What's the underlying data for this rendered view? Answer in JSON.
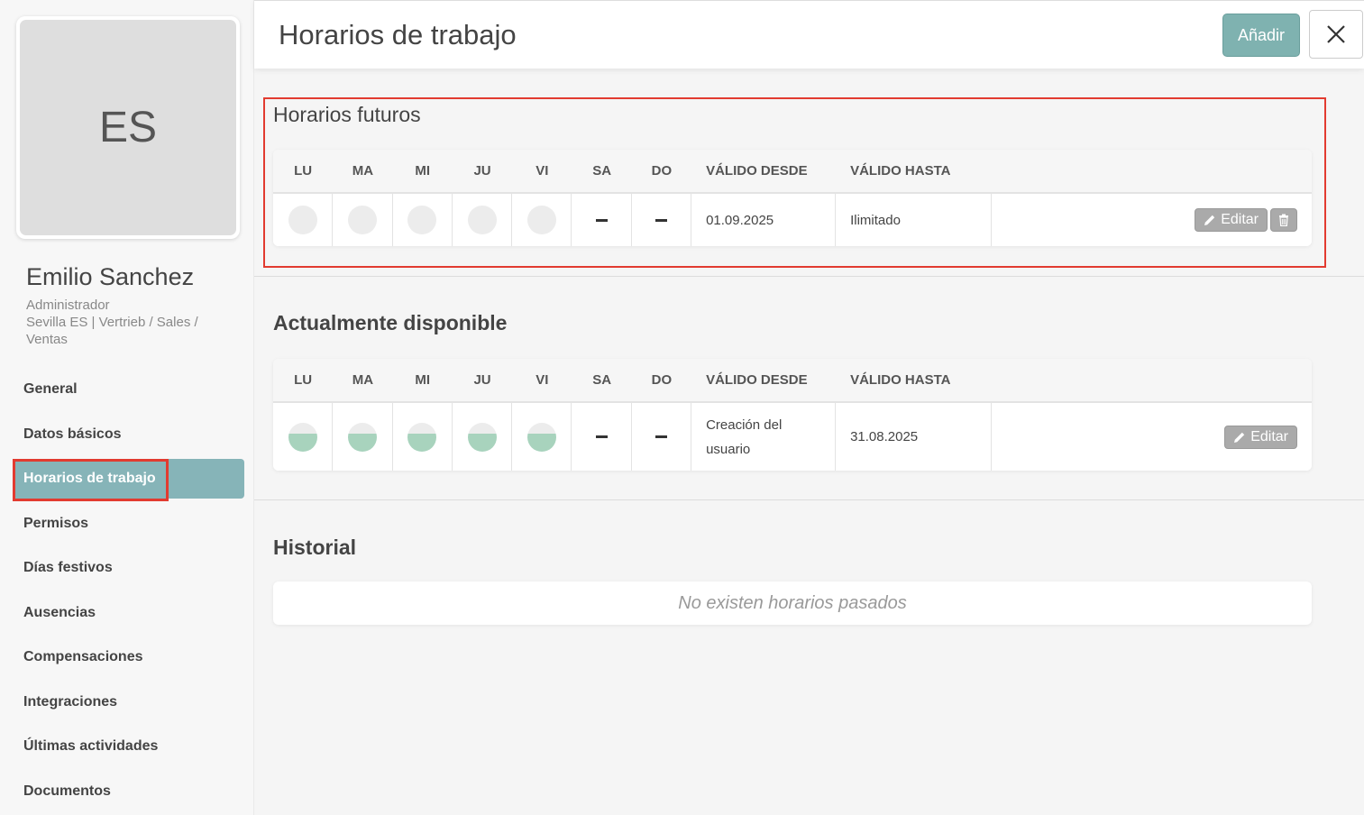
{
  "sidebar": {
    "avatar_initials": "ES",
    "user_name": "Emilio Sanchez",
    "user_role": "Administrador",
    "user_location": "Sevilla ES | Vertrieb / Sales / Ventas",
    "nav": [
      {
        "label": "General"
      },
      {
        "label": "Datos básicos"
      },
      {
        "label": "Horarios de trabajo",
        "active": true
      },
      {
        "label": "Permisos"
      },
      {
        "label": "Días festivos"
      },
      {
        "label": "Ausencias"
      },
      {
        "label": "Compensaciones"
      },
      {
        "label": "Integraciones"
      },
      {
        "label": "Últimas actividades"
      },
      {
        "label": "Documentos"
      }
    ]
  },
  "header": {
    "title": "Horarios de trabajo",
    "add_label": "Añadir",
    "close_icon": "close-icon"
  },
  "table_headers": [
    "LU",
    "MA",
    "MI",
    "JU",
    "VI",
    "SA",
    "DO",
    "VÁLIDO DESDE",
    "VÁLIDO HASTA"
  ],
  "future": {
    "title": "Horarios futuros",
    "row": {
      "days": [
        "empty",
        "empty",
        "empty",
        "empty",
        "empty",
        "off",
        "off"
      ],
      "valid_from": "01.09.2025",
      "valid_to": "Ilimitado",
      "edit_label": "Editar"
    }
  },
  "current": {
    "title": "Actualmente disponible",
    "row": {
      "days": [
        "half",
        "half",
        "half",
        "half",
        "half",
        "off",
        "off"
      ],
      "valid_from": "Creación del usuario",
      "valid_to": "31.08.2025",
      "edit_label": "Editar"
    }
  },
  "history": {
    "title": "Historial",
    "empty_text": "No existen horarios pasados"
  },
  "colors": {
    "accent": "#86b4b8",
    "add_button": "#7fb2b0",
    "highlight": "#e23b30",
    "half_fill": "#a8d3bd"
  }
}
